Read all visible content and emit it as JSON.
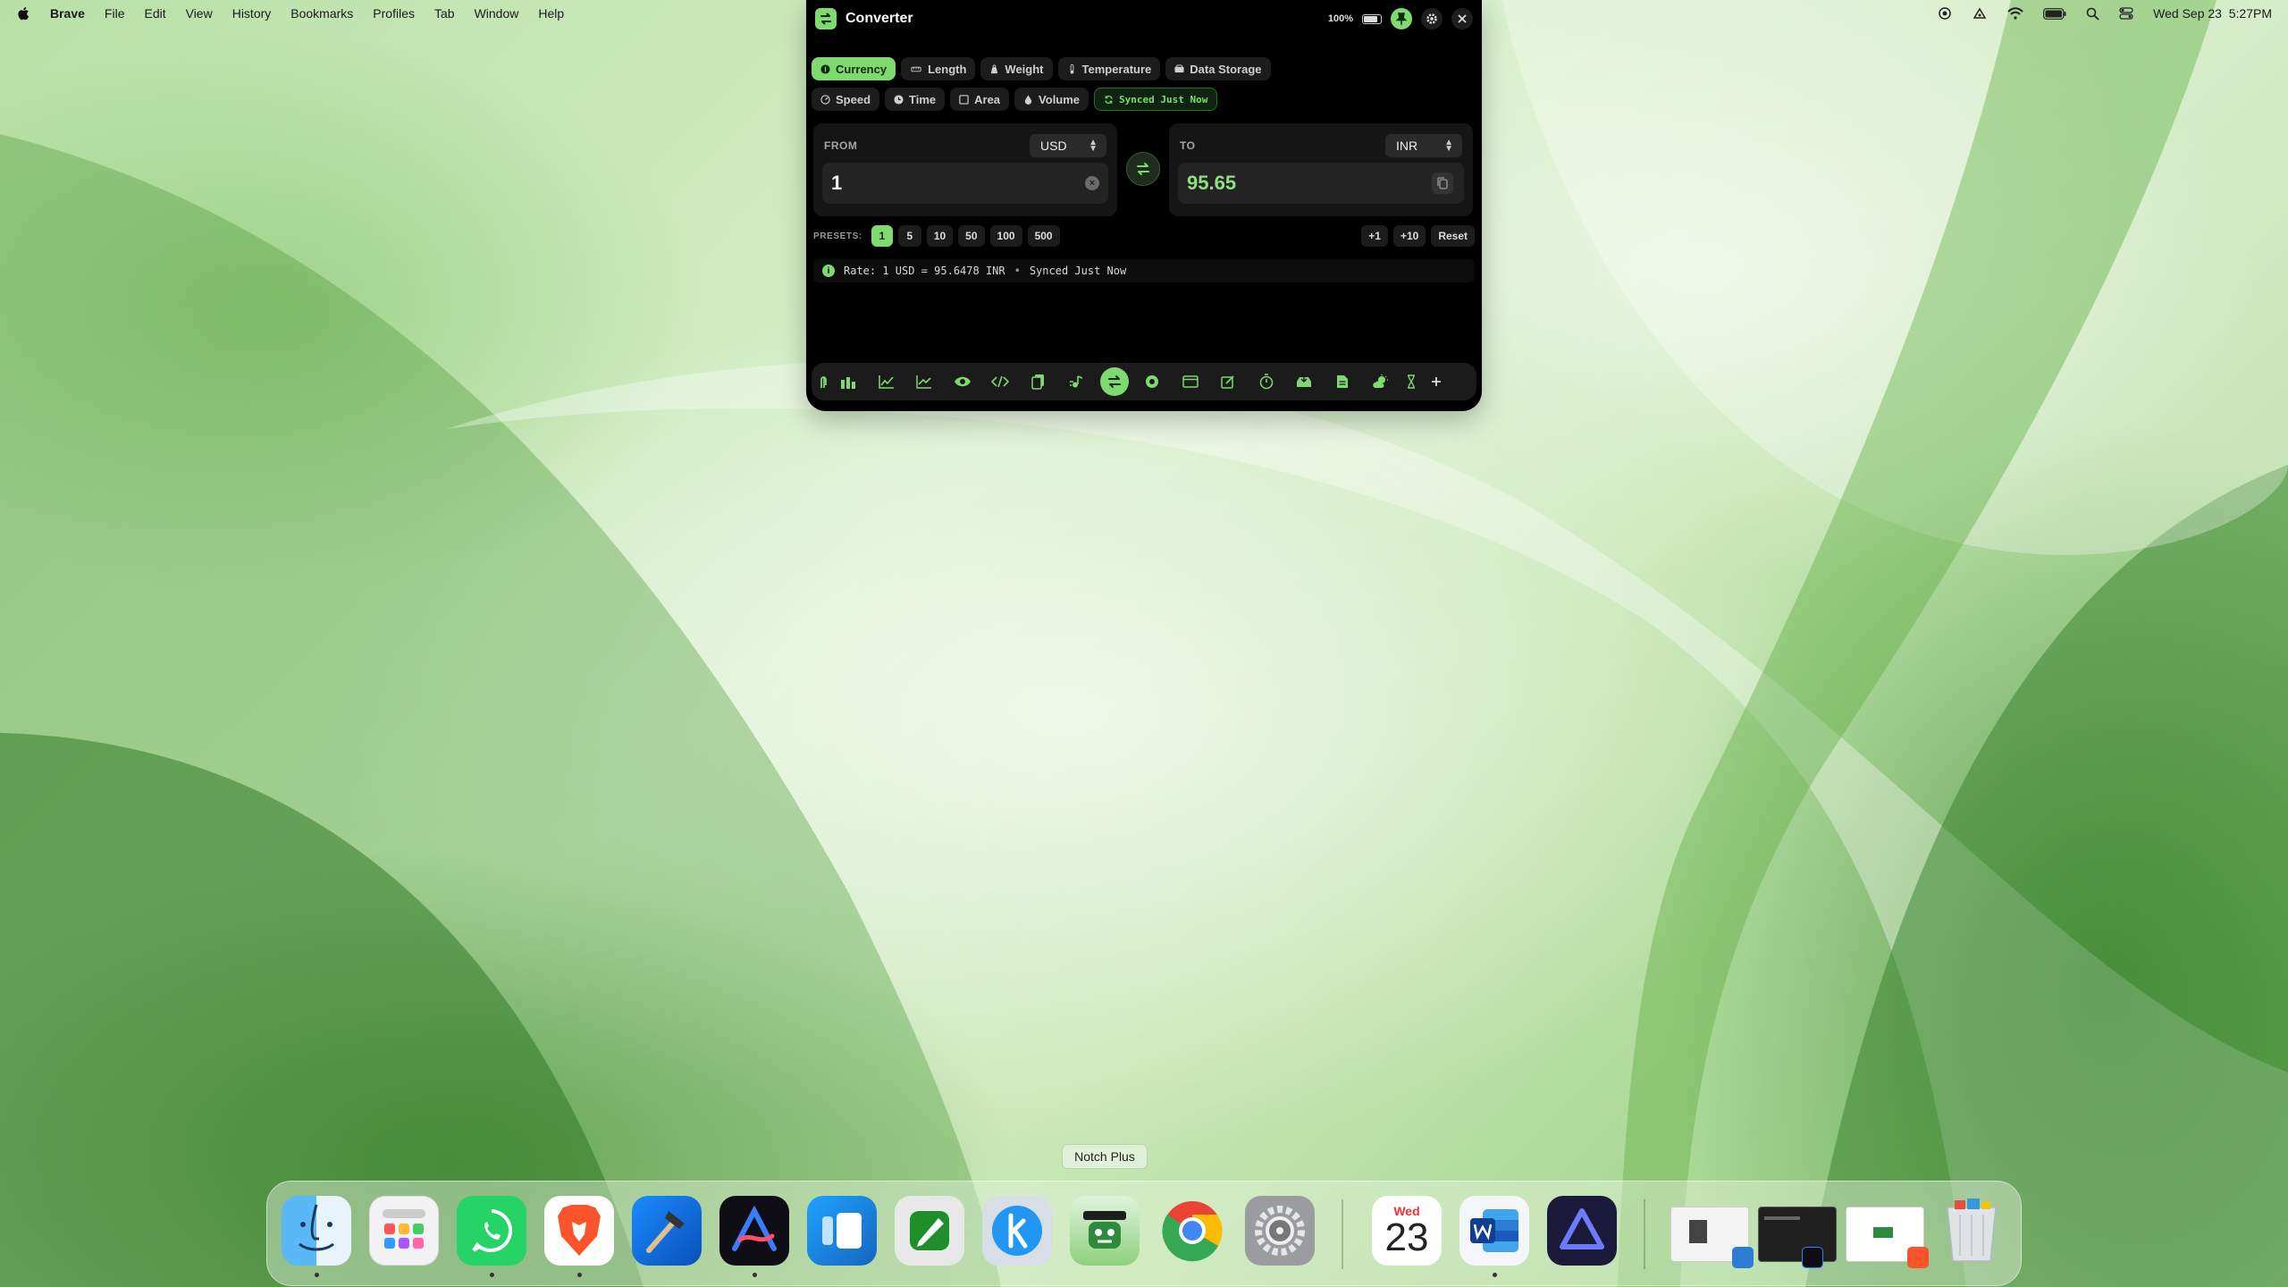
{
  "menubar": {
    "app_name": "Brave",
    "menus": [
      "File",
      "Edit",
      "View",
      "History",
      "Bookmarks",
      "Profiles",
      "Tab",
      "Window",
      "Help"
    ],
    "datetime": "Wed Sep 23  5:27PM"
  },
  "converter": {
    "title": "Converter",
    "battery": "100%",
    "tabs_row1": [
      {
        "label": "Currency",
        "icon": "currency-icon",
        "active": true
      },
      {
        "label": "Length",
        "icon": "ruler-icon"
      },
      {
        "label": "Weight",
        "icon": "weight-icon"
      },
      {
        "label": "Temperature",
        "icon": "thermometer-icon"
      },
      {
        "label": "Data Storage",
        "icon": "storage-icon"
      }
    ],
    "tabs_row2": [
      {
        "label": "Speed",
        "icon": "speed-icon"
      },
      {
        "label": "Time",
        "icon": "clock-icon"
      },
      {
        "label": "Area",
        "icon": "square-icon"
      },
      {
        "label": "Volume",
        "icon": "drop-icon"
      }
    ],
    "sync_label": "Synced Just Now",
    "from": {
      "label": "FROM",
      "currency": "USD",
      "value": "1"
    },
    "to": {
      "label": "TO",
      "currency": "INR",
      "value": "95.65"
    },
    "presets_label": "PRESETS:",
    "presets": [
      "1",
      "5",
      "10",
      "50",
      "100",
      "500"
    ],
    "active_preset": "1",
    "adjust": [
      "+1",
      "+10",
      "Reset"
    ],
    "rate_text": "Rate: 1 USD = 95.6478 INR",
    "rate_sync": "Synced Just Now",
    "accent_color": "#7ed96f"
  },
  "toolbar_tools": [
    "gesture-icon",
    "bar-chart-icon",
    "line-chart-icon",
    "trend-icon",
    "eye-icon",
    "code-icon",
    "clipboard-icon",
    "music-icon",
    "converter-icon",
    "record-icon",
    "window-icon",
    "note-icon",
    "timer-icon",
    "tray-icon",
    "document-icon",
    "weather-icon",
    "hourglass-icon",
    "add-icon"
  ],
  "tooltip": "Notch Plus",
  "dock": {
    "apps": [
      "Finder",
      "Launchpad",
      "WhatsApp",
      "Brave",
      "Xcode",
      "Arc",
      "Stage Manager",
      "Script Editor",
      "Klack",
      "Notch Plus",
      "Chrome",
      "System Settings",
      "Calendar",
      "Word",
      "Affinity"
    ],
    "calendar_day": "Wed",
    "calendar_date": "23"
  }
}
